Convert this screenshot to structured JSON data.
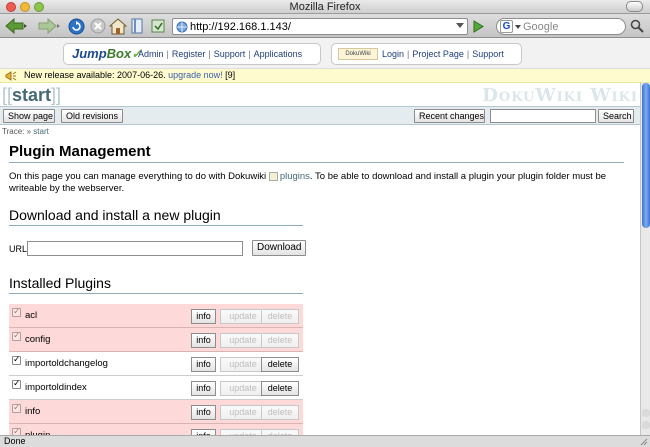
{
  "window": {
    "title": "Mozilla Firefox"
  },
  "toolbar": {
    "url": "http://192.168.1.143/",
    "search_placeholder": "Google",
    "search_engine_letter": "G"
  },
  "jumpbox": {
    "logo_part1": "Jump",
    "logo_part2": "Box",
    "links": [
      "Admin",
      "Register",
      "Support",
      "Applications"
    ],
    "dw_logo": "DokuWiki",
    "dw_links": [
      "Login",
      "Project Page",
      "Support"
    ]
  },
  "notice": {
    "text": "New release available: 2007-06-26.",
    "link": "upgrade now!",
    "tail": "[9]"
  },
  "wiki": {
    "brand_open": "[[",
    "brand_name": "start",
    "brand_close": "]]",
    "site_title": "DokuWiki Wiki",
    "show_page": "Show page",
    "old_revisions": "Old revisions",
    "recent_changes": "Recent changes",
    "search_button": "Search",
    "trace_label": "Trace:",
    "trace_sep": "»",
    "trace_link": "start"
  },
  "content": {
    "heading": "Plugin Management",
    "intro_before": "On this page you can manage everything to do with Dokuwiki ",
    "intro_link": "plugins",
    "intro_after": ". To be able to download and install a plugin your plugin folder must be writeable by the webserver.",
    "download_heading": "Download and install a new plugin",
    "url_label": "URL",
    "download_button": "Download",
    "installed_heading": "Installed Plugins"
  },
  "plugins": [
    {
      "name": "acl",
      "enabled": false,
      "info": "info",
      "update": "update",
      "delete": "delete",
      "update_enabled": false,
      "delete_enabled": false
    },
    {
      "name": "config",
      "enabled": false,
      "info": "info",
      "update": "update",
      "delete": "delete",
      "update_enabled": false,
      "delete_enabled": false
    },
    {
      "name": "importoldchangelog",
      "enabled": true,
      "info": "info",
      "update": "update",
      "delete": "delete",
      "update_enabled": false,
      "delete_enabled": true
    },
    {
      "name": "importoldindex",
      "enabled": true,
      "info": "info",
      "update": "update",
      "delete": "delete",
      "update_enabled": false,
      "delete_enabled": true
    },
    {
      "name": "info",
      "enabled": false,
      "info": "info",
      "update": "update",
      "delete": "delete",
      "update_enabled": false,
      "delete_enabled": false
    },
    {
      "name": "plugin",
      "enabled": false,
      "info": "info",
      "update": "update",
      "delete": "delete",
      "update_enabled": false,
      "delete_enabled": false
    }
  ],
  "status": {
    "text": "Done"
  }
}
